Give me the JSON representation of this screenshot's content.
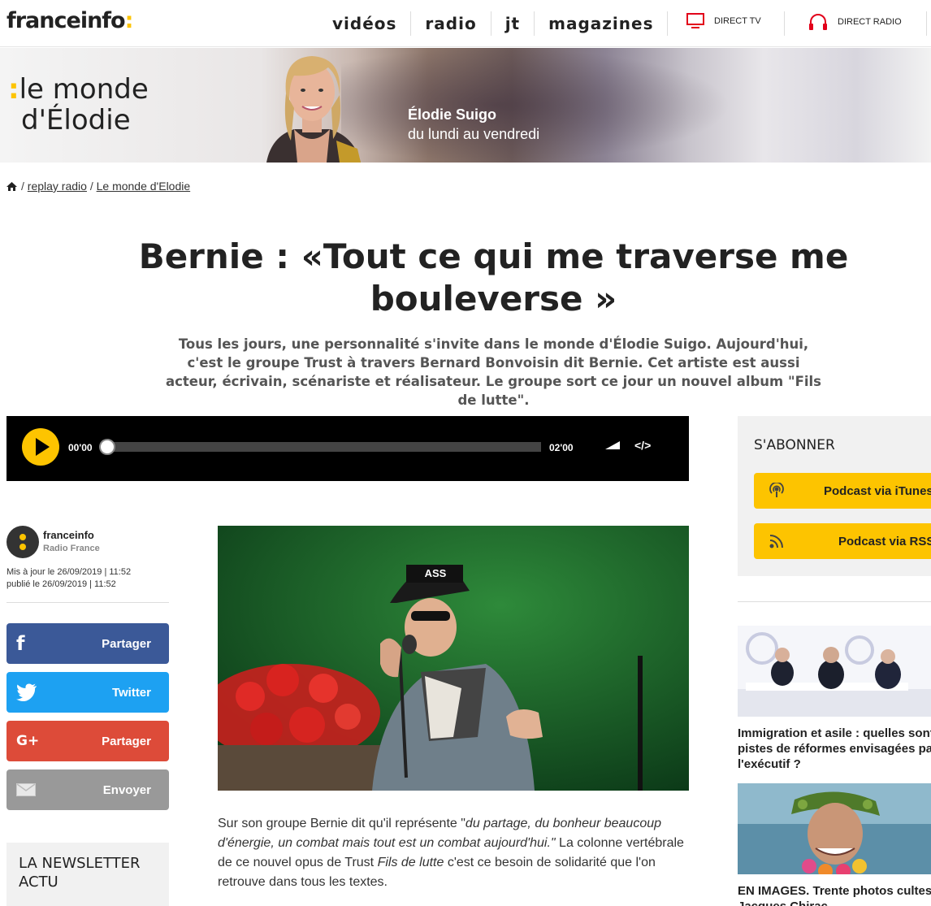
{
  "header": {
    "logo_text": "franceinfo",
    "logo_colon": ":",
    "nav": [
      "vidéos",
      "radio",
      "jt",
      "magazines"
    ],
    "direct_tv": "DIRECT TV",
    "direct_radio": "DIRECT RADIO"
  },
  "banner": {
    "colon": ":",
    "title_line1": "le monde",
    "title_line2": "d'Élodie",
    "host_name": "Élodie Suigo",
    "schedule": "du lundi au vendredi"
  },
  "breadcrumb": {
    "sep1": "/",
    "link1": "replay radio",
    "sep2": "/",
    "link2": "Le monde d'Elodie"
  },
  "article": {
    "title": "Bernie : «Tout ce qui me traverse me bouleverse »",
    "chapo": "Tous les jours, une personnalité s'invite dans le monde d'Élodie Suigo. Aujourd'hui, c'est le groupe Trust à travers Bernard Bonvoisin dit Bernie. Cet artiste est aussi acteur, écrivain, scénariste et réalisateur. Le groupe  sort ce jour un nouvel album  \"Fils de lutte\".",
    "body_plain1": "Sur son groupe Bernie dit qu'il représente \"",
    "body_italic1": "du partage, du bonheur beaucoup d'énergie, un combat mais tout est un combat aujourd'hui.\"",
    "body_plain2": " La colonne vertébrale de ce nouvel opus de Trust ",
    "body_italic2": "Fils de lutte",
    "body_plain3": " c'est ce besoin de solidarité que l'on retrouve dans tous les textes.",
    "image_cap_text": "ASS"
  },
  "player": {
    "current_time": "00'00",
    "duration": "02'00",
    "embed_label": "</>",
    "progress": 0
  },
  "author": {
    "name": "franceinfo",
    "org": "Radio France",
    "updated": "Mis à jour le 26/09/2019 | 11:52",
    "published": "publié le 26/09/2019 | 11:52"
  },
  "share": {
    "facebook_icon": "f",
    "facebook": "Partager",
    "twitter": "Twitter",
    "googleplus_icon": "G+",
    "googleplus": "Partager",
    "email": "Envoyer"
  },
  "newsletter": {
    "title": "LA NEWSLETTER ACTU"
  },
  "subscribe": {
    "title": "S'ABONNER",
    "podcast1": "Podcast via iTunes",
    "podcast2": "Podcast via RSS"
  },
  "related": [
    {
      "title_line1": "Immigration et asile : quelles sont les",
      "title_line2": "pistes de réformes envisagées par",
      "title_line3": "l'exécutif ?"
    },
    {
      "title_line1": "EN IMAGES. Trente photos cultes de",
      "title_line2": "Jacques Chirac"
    }
  ],
  "colors": {
    "accent": "#fdc400",
    "facebook": "#3b5998",
    "twitter": "#1da1f2",
    "googleplus": "#dd4b39",
    "email": "#999999"
  }
}
